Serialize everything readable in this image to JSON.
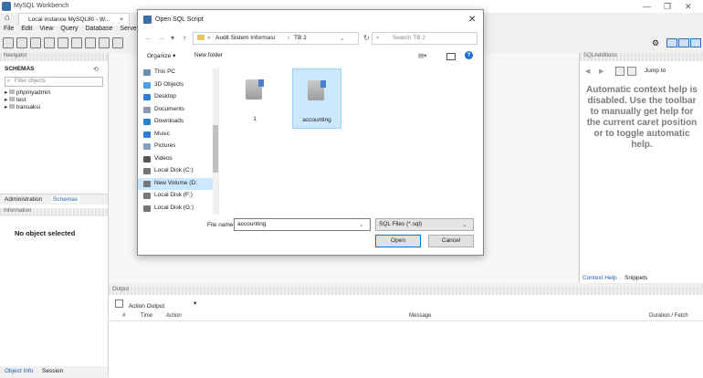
{
  "app": {
    "title": "MySQL Workbench",
    "connection_tab": "Local instance MySQL80 - W...",
    "tab_close": "×",
    "window_controls": [
      "—",
      "❐",
      "✕"
    ]
  },
  "menu": [
    "File",
    "Edit",
    "View",
    "Query",
    "Database",
    "Server"
  ],
  "navigator": {
    "header": "Navigator",
    "schemas_label": "SCHEMAS",
    "filter_placeholder": "Filter objects",
    "schemas": [
      "phpmyadmin",
      "test",
      "transaksi"
    ],
    "tabs": [
      "Administration",
      "Schemas"
    ],
    "information_header": "Information",
    "no_object": "No object selected",
    "bottom_tabs": [
      "Object Info",
      "Session"
    ]
  },
  "sql_additions": {
    "header": "SQLAdditions",
    "jump_to": "Jump to",
    "help_text": "Automatic context help is disabled. Use the toolbar to manually get help for the current caret position or to toggle automatic help.",
    "tabs": [
      "Context Help",
      "Snippets"
    ]
  },
  "output": {
    "header": "Output",
    "selector": "Action Output",
    "columns": [
      "#",
      "Time",
      "Action",
      "Message",
      "Duration / Fetch"
    ]
  },
  "dialog": {
    "title": "Open SQL Script",
    "close": "✕",
    "breadcrumb": [
      "«",
      "Audit Sistem Informasi",
      "›",
      "TB 2"
    ],
    "search_placeholder": "Search TB 2",
    "organize": "Organize ▾",
    "new_folder": "New folder",
    "nav_items": [
      {
        "label": "This PC",
        "color": "#6a8fb5"
      },
      {
        "label": "3D Objects",
        "color": "#4aa0e0"
      },
      {
        "label": "Desktop",
        "color": "#2d7fd3"
      },
      {
        "label": "Documents",
        "color": "#8e9aaa"
      },
      {
        "label": "Downloads",
        "color": "#2d7fd3"
      },
      {
        "label": "Music",
        "color": "#2d7fd3"
      },
      {
        "label": "Pictures",
        "color": "#7fa0c0"
      },
      {
        "label": "Videos",
        "color": "#555555"
      },
      {
        "label": "Local Disk (C:)",
        "color": "#777777"
      },
      {
        "label": "New Volume (D:",
        "color": "#777777"
      },
      {
        "label": "Local Disk (F:)",
        "color": "#777777"
      },
      {
        "label": "Local Disk (G:)",
        "color": "#777777"
      }
    ],
    "files": [
      "1",
      "accounting"
    ],
    "file_name_label": "File name:",
    "file_name_value": "accounting",
    "file_type": "SQL Files (*.sql)",
    "open_label": "Open",
    "cancel_label": "Cancel"
  }
}
